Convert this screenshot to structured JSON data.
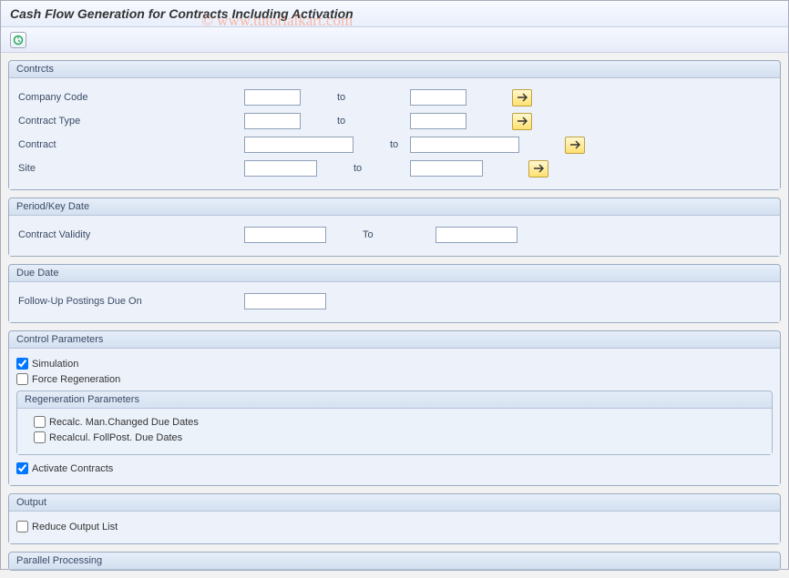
{
  "title": "Cash Flow Generation for Contracts Including Activation",
  "watermark": "© www.tutorialkart.com",
  "groups": {
    "contracts": {
      "title": "Contrcts",
      "fields": {
        "company_code": {
          "label": "Company Code",
          "from": "",
          "to_label": "to",
          "to": ""
        },
        "contract_type": {
          "label": "Contract Type",
          "from": "",
          "to_label": "to",
          "to": ""
        },
        "contract": {
          "label": "Contract",
          "from": "",
          "to_label": "to",
          "to": ""
        },
        "site": {
          "label": "Site",
          "from": "",
          "to_label": "to",
          "to": ""
        }
      }
    },
    "period": {
      "title": "Period/Key Date",
      "fields": {
        "validity": {
          "label": "Contract Validity",
          "from": "",
          "to_label": "To",
          "to": ""
        }
      }
    },
    "due_date": {
      "title": "Due Date",
      "fields": {
        "followup": {
          "label": "Follow-Up Postings Due On",
          "value": ""
        }
      }
    },
    "control": {
      "title": "Control Parameters",
      "simulation": {
        "label": "Simulation",
        "checked": true
      },
      "force_regen": {
        "label": "Force Regeneration",
        "checked": false
      },
      "regen_params": {
        "title": "Regeneration Parameters",
        "recalc_man": {
          "label": "Recalc. Man.Changed Due Dates",
          "checked": false
        },
        "recalc_foll": {
          "label": "Recalcul. FollPost. Due Dates",
          "checked": false
        }
      },
      "activate": {
        "label": "Activate Contracts",
        "checked": true
      }
    },
    "output": {
      "title": "Output",
      "reduce": {
        "label": "Reduce Output List",
        "checked": false
      }
    },
    "parallel": {
      "title": "Parallel Processing"
    }
  }
}
